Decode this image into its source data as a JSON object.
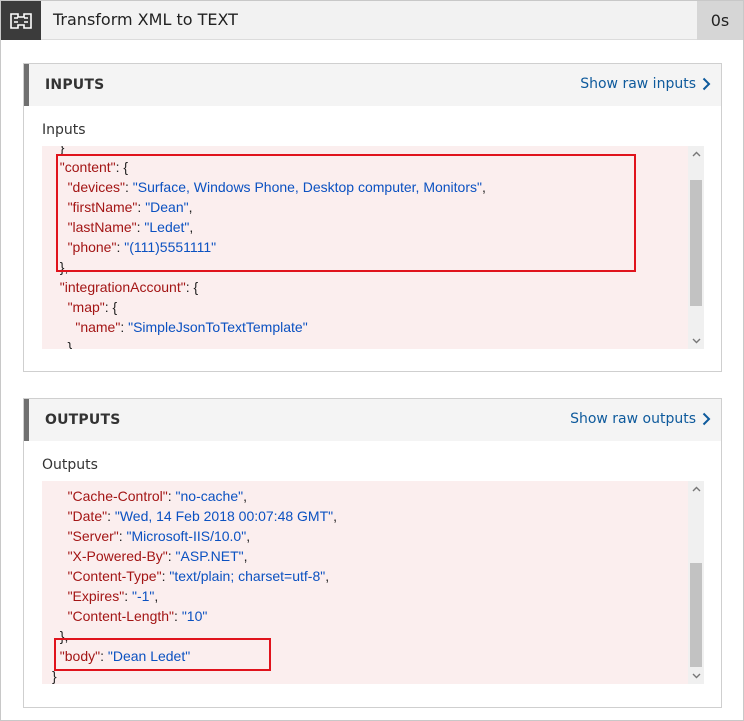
{
  "header": {
    "title": "Transform XML to TEXT",
    "duration": "0s"
  },
  "inputs": {
    "panel_title": "INPUTS",
    "raw_link": "Show raw inputs",
    "section_label": "Inputs",
    "lines": [
      "  }",
      "  \"content\": {",
      "    \"devices\": \"Surface, Windows Phone, Desktop computer, Monitors\",",
      "    \"firstName\": \"Dean\",",
      "    \"lastName\": \"Ledet\",",
      "    \"phone\": \"(111)5551111\"",
      "  },",
      "  \"integrationAccount\": {",
      "    \"map\": {",
      "      \"name\": \"SimpleJsonToTextTemplate\"",
      "    }"
    ]
  },
  "outputs": {
    "panel_title": "OUTPUTS",
    "raw_link": "Show raw outputs",
    "section_label": "Outputs",
    "lines": [
      "    \"Cache-Control\": \"no-cache\",",
      "    \"Date\": \"Wed, 14 Feb 2018 00:07:48 GMT\",",
      "    \"Server\": \"Microsoft-IIS/10.0\",",
      "    \"X-Powered-By\": \"ASP.NET\",",
      "    \"Content-Type\": \"text/plain; charset=utf-8\",",
      "    \"Expires\": \"-1\",",
      "    \"Content-Length\": \"10\"",
      "  },",
      "  \"body\": \"Dean Ledet\"",
      "}"
    ]
  },
  "colors": {
    "key": "#a31515",
    "value": "#0b51c1",
    "link": "#0e5a9c",
    "highlight": "#e0131c",
    "code_background": "#fbeeee"
  },
  "icons": {
    "action": "transform-icon",
    "link_arrow": "chevron-right-icon"
  }
}
